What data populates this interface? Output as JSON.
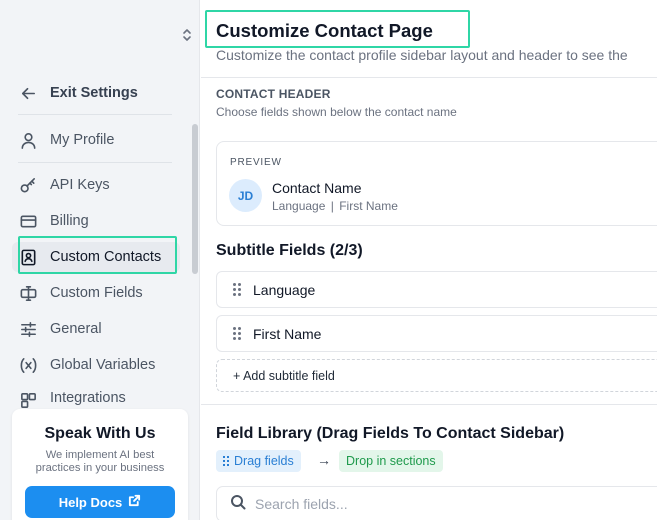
{
  "sidebar": {
    "exit_label": "Exit Settings",
    "items": [
      {
        "label": "My Profile",
        "icon": "user-icon"
      },
      {
        "label": "API Keys",
        "icon": "key-icon"
      },
      {
        "label": "Billing",
        "icon": "credit-card-icon"
      },
      {
        "label": "Custom Contacts",
        "icon": "contact-card-icon"
      },
      {
        "label": "Custom Fields",
        "icon": "custom-fields-icon"
      },
      {
        "label": "General",
        "icon": "sliders-icon"
      },
      {
        "label": "Global Variables",
        "icon": "variable-icon"
      },
      {
        "label": "Integrations",
        "icon": "integrations-icon"
      }
    ],
    "active_item": "Custom Contacts",
    "speak_card": {
      "title": "Speak With Us",
      "description": "We implement AI best practices in your business",
      "button_label": "Help Docs"
    }
  },
  "main": {
    "title": "Customize Contact Page",
    "subtitle": "Customize the contact profile sidebar layout and header to see the",
    "contact_header": {
      "label": "CONTACT HEADER",
      "description": "Choose fields shown below the contact name"
    },
    "preview": {
      "label": "PREVIEW",
      "initials": "JD",
      "name": "Contact Name",
      "meta_first": "Language",
      "meta_sep": "|",
      "meta_second": "First Name"
    },
    "subtitle_fields": {
      "heading": "Subtitle Fields (2/3)",
      "fields": [
        "Language",
        "First Name"
      ],
      "add_label": "+ Add subtitle field"
    },
    "field_library": {
      "heading": "Field Library (Drag Fields To Contact Sidebar)",
      "drag_chip": "Drag fields",
      "arrow": "→",
      "drop_chip": "Drop in sections",
      "search_placeholder": "Search fields..."
    }
  },
  "colors": {
    "accent_blue": "#1c8ef0",
    "highlight_green": "#2fd6a6",
    "drop_green": "#1f9a4c"
  }
}
